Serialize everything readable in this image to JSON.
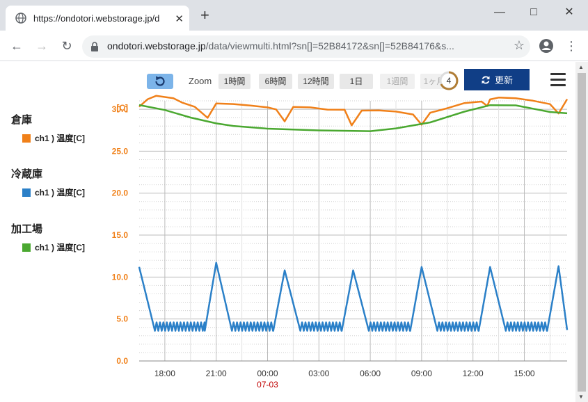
{
  "browser": {
    "tab_title": "https://ondotori.webstorage.jp/d",
    "tab_close": "✕",
    "new_tab": "+",
    "url_host": "ondotori.webstorage.jp",
    "url_path": "/data/viewmulti.html?sn[]=52B84172&sn[]=52B84176&s..."
  },
  "toolbar": {
    "zoom_label": "Zoom",
    "zoom_buttons": [
      "1時間",
      "6時間",
      "12時間",
      "1日",
      "1週間",
      "1ヶ月"
    ],
    "countdown": "4",
    "update_label": "更新"
  },
  "legend": [
    {
      "group": "倉庫",
      "item": "ch1 ) 温度[C]",
      "color": "#f08019"
    },
    {
      "group": "冷蔵庫",
      "item": "ch1 ) 温度[C]",
      "color": "#2b80c8"
    },
    {
      "group": "加工場",
      "item": "ch1 ) 温度[C]",
      "color": "#4aa830"
    }
  ],
  "chart_data": {
    "type": "line",
    "unit_label": "[C]",
    "ylim": [
      0,
      31
    ],
    "y_ticks": [
      "0.0",
      "5.0",
      "10.0",
      "15.0",
      "20.0",
      "25.0",
      "30.0"
    ],
    "x_ticks": [
      "18:00",
      "21:00",
      "00:00",
      "03:00",
      "06:00",
      "09:00",
      "12:00",
      "15:00"
    ],
    "date_label": "07-03",
    "x_range": [
      "16:30",
      "17:30"
    ],
    "grid": true,
    "colors": {
      "axis_labels": "#f08019",
      "date": "#c00000"
    },
    "series": [
      {
        "name": "倉庫 ch1 ) 温度[C]",
        "color": "#f08019",
        "points": [
          [
            "16:30",
            30.3
          ],
          [
            "17:00",
            31.1
          ],
          [
            "17:30",
            31.5
          ],
          [
            "18:30",
            31.3
          ],
          [
            "19:00",
            30.9
          ],
          [
            "19:45",
            30.4
          ],
          [
            "20:30",
            29.0
          ],
          [
            "21:00",
            30.6
          ],
          [
            "22:00",
            30.5
          ],
          [
            "23:00",
            30.4
          ],
          [
            "00:00",
            30.3
          ],
          [
            "00:30",
            30.1
          ],
          [
            "01:00",
            28.6
          ],
          [
            "01:30",
            30.2
          ],
          [
            "02:30",
            30.1
          ],
          [
            "03:30",
            29.9
          ],
          [
            "04:30",
            30.0
          ],
          [
            "04:55",
            28.2
          ],
          [
            "05:30",
            29.9
          ],
          [
            "06:30",
            29.8
          ],
          [
            "07:30",
            29.6
          ],
          [
            "08:30",
            29.3
          ],
          [
            "09:00",
            28.2
          ],
          [
            "09:30",
            29.7
          ],
          [
            "10:30",
            30.2
          ],
          [
            "11:30",
            30.7
          ],
          [
            "12:30",
            30.8
          ],
          [
            "12:50",
            30.3
          ],
          [
            "13:00",
            31.2
          ],
          [
            "13:30",
            31.5
          ],
          [
            "14:30",
            31.4
          ],
          [
            "15:30",
            31.0
          ],
          [
            "16:30",
            30.5
          ],
          [
            "17:00",
            29.4
          ],
          [
            "17:30",
            31.2
          ]
        ]
      },
      {
        "name": "冷蔵庫 ch1 ) 温度[C]",
        "color": "#2b80c8",
        "peaks": [
          [
            "16:30",
            11.2
          ],
          [
            "21:00",
            11.7
          ],
          [
            "01:00",
            10.8
          ],
          [
            "05:00",
            10.8
          ],
          [
            "09:00",
            11.2
          ],
          [
            "13:00",
            11.2
          ],
          [
            "17:00",
            11.3
          ]
        ],
        "baseline_min": 3.6,
        "baseline_max": 4.6,
        "end_value": 3.7
      },
      {
        "name": "加工場 ch1 ) 温度[C]",
        "color": "#4aa830",
        "points": [
          [
            "16:30",
            30.5
          ],
          [
            "18:00",
            29.8
          ],
          [
            "19:30",
            28.9
          ],
          [
            "21:00",
            28.3
          ],
          [
            "22:00",
            28.1
          ],
          [
            "00:00",
            27.8
          ],
          [
            "03:00",
            27.5
          ],
          [
            "06:00",
            27.3
          ],
          [
            "07:30",
            27.6
          ],
          [
            "09:30",
            28.4
          ],
          [
            "11:30",
            29.8
          ],
          [
            "13:00",
            30.6
          ],
          [
            "14:30",
            30.5
          ],
          [
            "16:30",
            29.6
          ],
          [
            "17:30",
            29.4
          ]
        ]
      }
    ]
  }
}
